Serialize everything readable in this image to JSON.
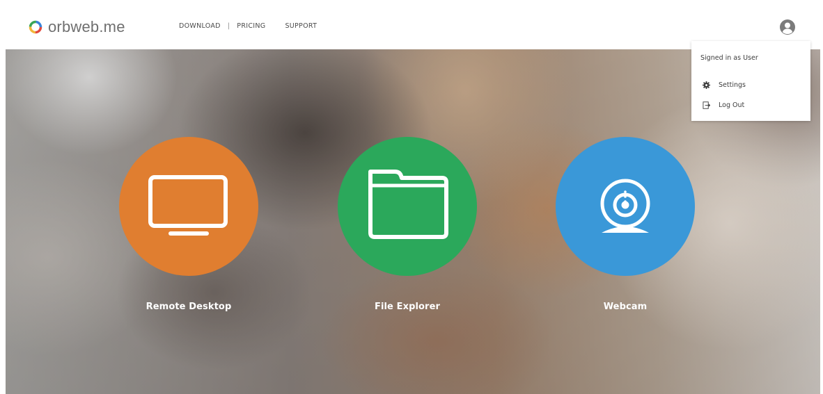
{
  "header": {
    "brand_name": "orbweb.me",
    "nav": {
      "download": "DOWNLOAD",
      "separator": "|",
      "pricing": "PRICING",
      "support": "SUPPORT"
    },
    "user_icon": "user-circle-icon"
  },
  "user_menu": {
    "signed_in_text": "Signed in as User",
    "items": [
      {
        "label": "Settings",
        "icon": "gear-icon"
      },
      {
        "label": "Log Out",
        "icon": "logout-icon"
      }
    ]
  },
  "features": [
    {
      "label": "Remote Desktop",
      "icon": "monitor-icon",
      "color": "#e07e30"
    },
    {
      "label": "File Explorer",
      "icon": "folder-icon",
      "color": "#2ba85b"
    },
    {
      "label": "Webcam",
      "icon": "webcam-icon",
      "color": "#3a98d8"
    }
  ],
  "colors": {
    "brand_logo_ring": [
      "#e2473b",
      "#f2b73a",
      "#3aa556",
      "#3a83d8"
    ],
    "nav_text": "#4a4a4a"
  }
}
